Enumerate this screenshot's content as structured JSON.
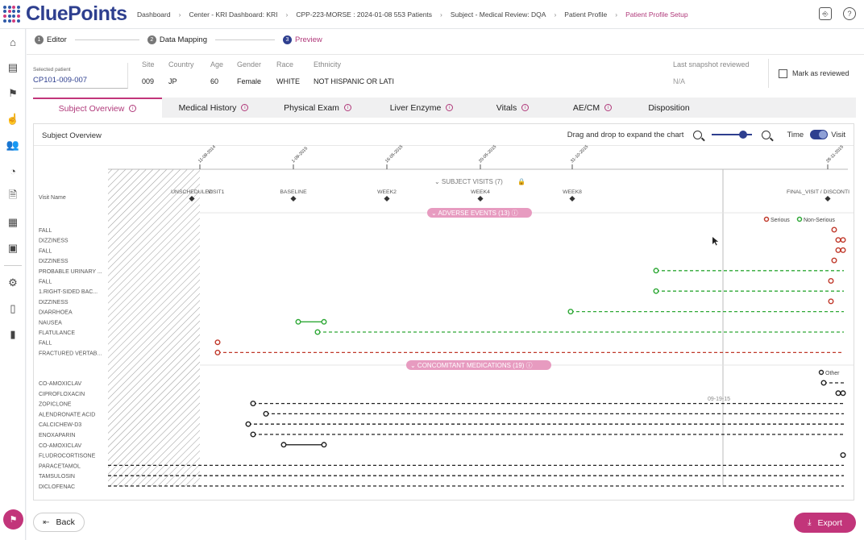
{
  "brand": {
    "name": "CluePoints",
    "accent": "#c2357a",
    "primary": "#2e3f8f"
  },
  "breadcrumbs": [
    "Dashboard",
    "Center - KRI Dashboard: KRI",
    "CPP-223-MORSE : 2024-01-08 553 Patients",
    "Subject - Medical Review: DQA",
    "Patient Profile",
    "Patient Profile Setup"
  ],
  "top_icons": [
    "chat-translate-icon",
    "help-icon"
  ],
  "sidebar": [
    "home-icon",
    "dashboard-icon",
    "flag-icon",
    "hand-pointer-icon",
    "patients-icon",
    "gauge-icon",
    "report-icon",
    "calendar-icon",
    "table-icon",
    "gear-icon",
    "book-icon",
    "document-icon"
  ],
  "steps": [
    {
      "num": "1",
      "label": "Editor"
    },
    {
      "num": "2",
      "label": "Data Mapping"
    },
    {
      "num": "3",
      "label": "Preview"
    }
  ],
  "patient": {
    "selected_label": "Selected patient",
    "selected_value": "CP101-009-007",
    "fields": [
      {
        "h": "Site",
        "v": "009"
      },
      {
        "h": "Country",
        "v": "JP"
      },
      {
        "h": "Age",
        "v": "60"
      },
      {
        "h": "Gender",
        "v": "Female"
      },
      {
        "h": "Race",
        "v": "WHITE"
      },
      {
        "h": "Ethnicity",
        "v": "NOT HISPANIC OR LATI"
      }
    ],
    "snapshot_label": "Last snapshot reviewed",
    "snapshot_value": "N/A",
    "mark_reviewed": "Mark as reviewed"
  },
  "tabs": [
    {
      "label": "Subject Overview",
      "info": true
    },
    {
      "label": "Medical History",
      "info": true
    },
    {
      "label": "Physical Exam",
      "info": true
    },
    {
      "label": "Liver Enzyme",
      "info": true
    },
    {
      "label": "Vitals",
      "info": true
    },
    {
      "label": "AE/CM",
      "info": true
    },
    {
      "label": "Disposition",
      "info": false
    }
  ],
  "panel": {
    "title": "Subject Overview",
    "drag_hint": "Drag and drop to expand the chart",
    "time_label": "Time",
    "visit_label": "Visit",
    "visit_name_header": "Visit Name"
  },
  "chart_data": {
    "type": "timeline",
    "date_ticks": [
      "11-08-2014",
      "1-09-2015",
      "16-05-2015",
      "20-05-2015",
      "31-10-2015",
      "28-11-2015"
    ],
    "hover_date": "09-19-15",
    "visits_header": "SUBJECT VISITS (7)",
    "visits": [
      "UNSCHEDULED",
      "VISIT1",
      "BASELINE",
      "WEEK2",
      "WEEK4",
      "WEEK8",
      "FINAL_VISIT / DISCONTI"
    ],
    "ae_header": "ADVERSE EVENTS (13)",
    "ae_legend": [
      "Serious",
      "Non-Serious"
    ],
    "adverse_events": [
      "FALL",
      "DIZZINESS",
      "FALL",
      "DIZZINESS",
      "PROBABLE URINARY ...",
      "FALL",
      "1.RIGHT-SIDED BAC...",
      "DIZZINESS",
      "DIARRHOEA",
      "NAUSEA",
      "FLATULANCE",
      "FALL",
      "FRACTURED VERTAB..."
    ],
    "cm_header": "CONCOMITANT MEDICATIONS (19)",
    "cm_legend": [
      "Other"
    ],
    "medications": [
      "CO-AMOXICLAV",
      "CIPROFLOXACIN",
      "ZOPICLONE",
      "ALENDRONATE ACID",
      "CALCICHEW-D3",
      "ENOXAPARIN",
      "CO-AMOXICLAV",
      "FLUDROCORTISONE",
      "PARACETAMOL",
      "TAMSULOSIN",
      "DICLOFENAC"
    ]
  },
  "footer": {
    "back": "Back",
    "export": "Export"
  }
}
